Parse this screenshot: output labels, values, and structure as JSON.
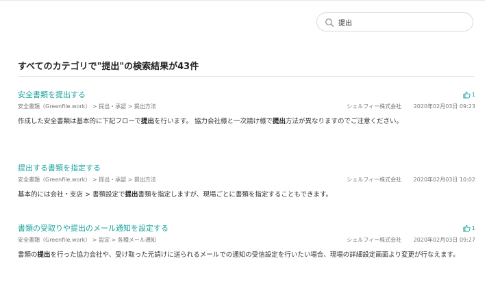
{
  "search": {
    "value": "提出",
    "icon": "search-icon"
  },
  "results_heading": "すべてのカテゴリで\"提出\"の検索結果が43件",
  "results": [
    {
      "title": "安全書類を提出する",
      "breadcrumb": "安全書類（Greenfile.work） > 提出・承認 > 提出方法",
      "company": "シェルフィー株式会社",
      "date": "2020年02月03日 09:23",
      "likes": "1",
      "excerpt": [
        {
          "text": "作成した安全書類は基本的に下記フローで",
          "highlight": false
        },
        {
          "text": "提出",
          "highlight": true
        },
        {
          "text": "を行います。 協力会社様と一次請け様で",
          "highlight": false
        },
        {
          "text": "提出",
          "highlight": true
        },
        {
          "text": "方法が異なりますのでご注意ください。",
          "highlight": false
        }
      ]
    },
    {
      "title": "提出する書類を指定する",
      "breadcrumb": "安全書類（Greenfile.work） > 提出・承認 > 提出方法",
      "company": "シェルフィー株式会社",
      "date": "2020年02月03日 10:02",
      "likes": "",
      "excerpt": [
        {
          "text": "基本的には会社・支店 > 書類設定で",
          "highlight": false
        },
        {
          "text": "提出",
          "highlight": true
        },
        {
          "text": "書類を指定しますが、現場ごとに書類を指定することもできます。",
          "highlight": false
        }
      ]
    },
    {
      "title": "書類の受取りや提出のメール通知を設定する",
      "breadcrumb": "安全書類（Greenfile.work） > 設定 > 各種メール通知",
      "company": "シェルフィー株式会社",
      "date": "2020年02月03日 09:27",
      "likes": "1",
      "excerpt": [
        {
          "text": "書類の",
          "highlight": false
        },
        {
          "text": "提出",
          "highlight": true
        },
        {
          "text": "を行った協力会社や、受け取った元請けに送られるメールでの通知の受信設定を行いたい場合、現場の詳細設定画面より変更が行なえます。",
          "highlight": false
        }
      ]
    }
  ],
  "colors": {
    "accent": "#1aa39e",
    "text": "#333333",
    "meta": "#777777"
  },
  "like_icon": "thumbs-up-icon"
}
